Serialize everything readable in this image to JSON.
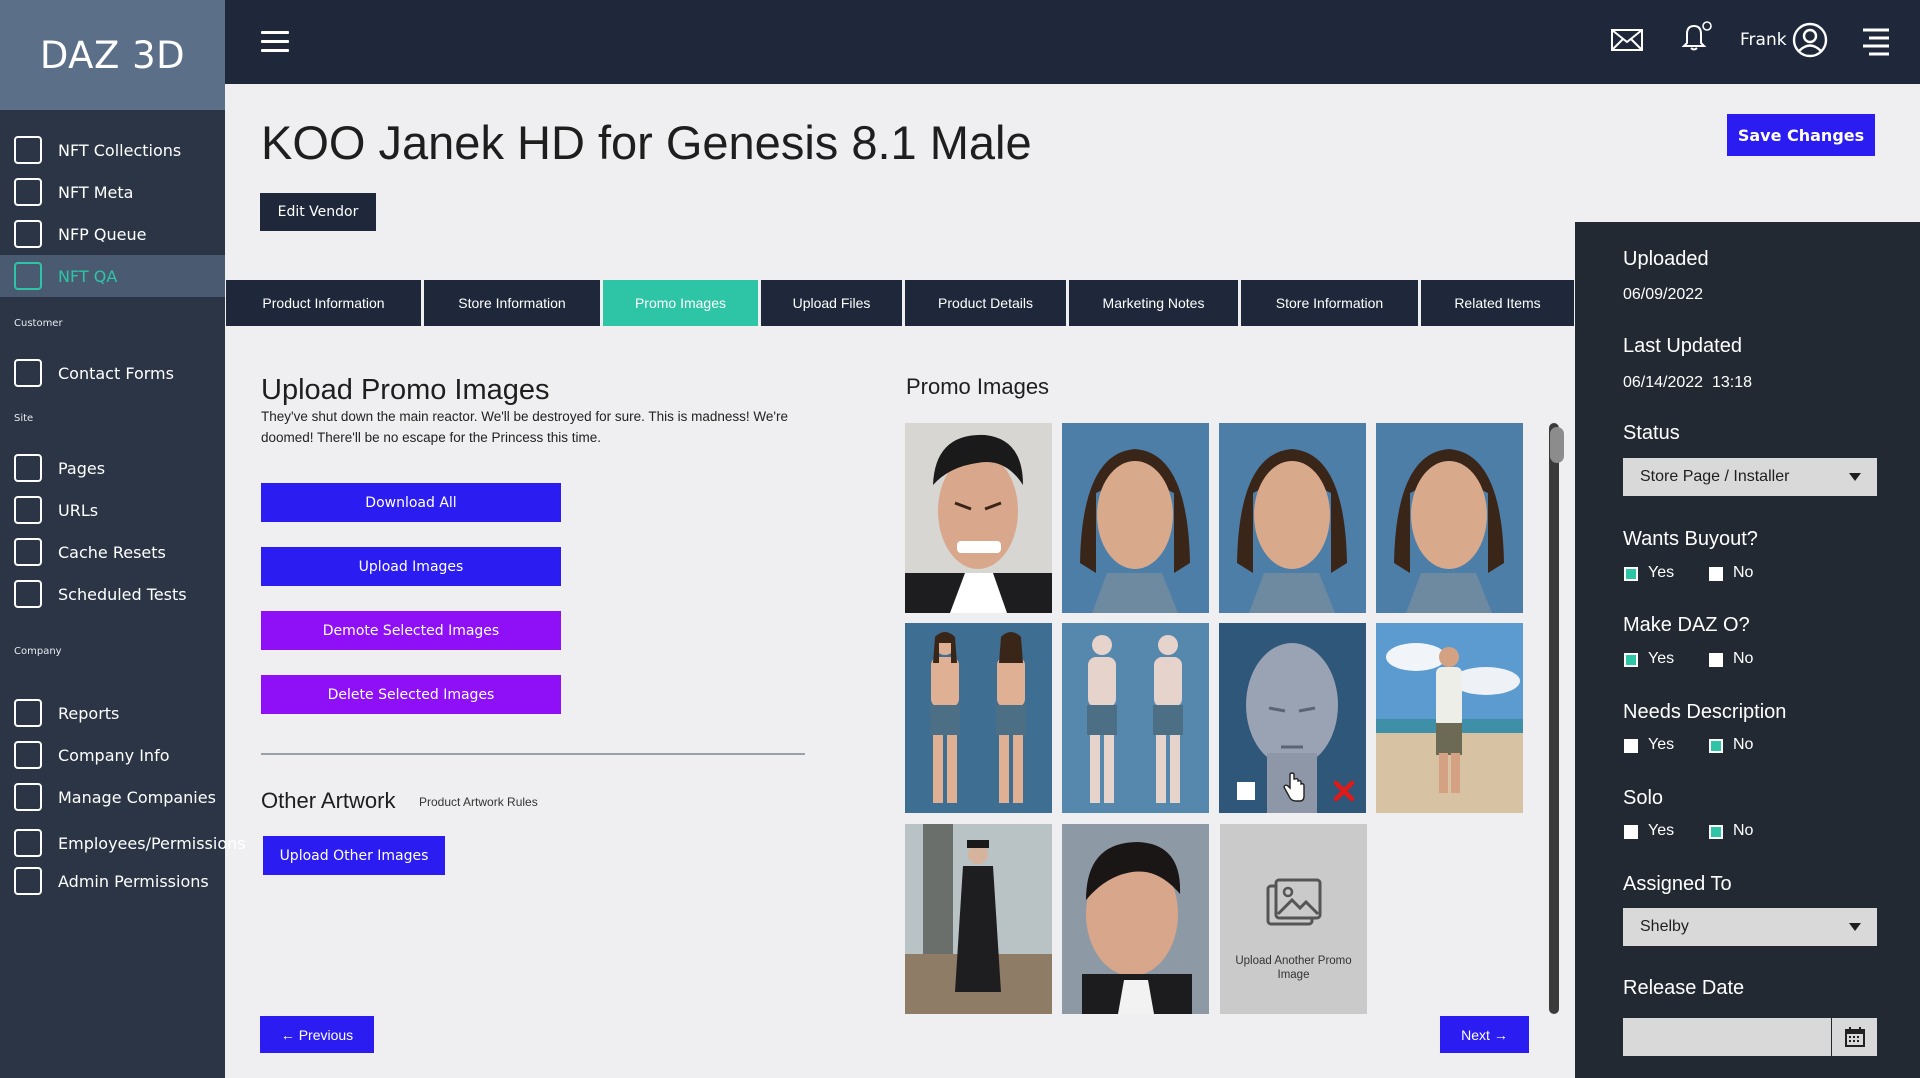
{
  "app": {
    "brand": "DAZ 3D"
  },
  "sidebar": {
    "items_top": [
      {
        "label": "NFT Collections"
      },
      {
        "label": "NFT Meta"
      },
      {
        "label": "NFP Queue"
      },
      {
        "label": "NFT QA",
        "active": true
      }
    ],
    "section_customer": "Customer",
    "items_customer": [
      {
        "label": "Contact Forms"
      }
    ],
    "section_site": "Site",
    "items_site": [
      {
        "label": "Pages"
      },
      {
        "label": "URLs"
      },
      {
        "label": "Cache Resets"
      },
      {
        "label": "Scheduled Tests"
      }
    ],
    "section_company": "Company",
    "items_company": [
      {
        "label": "Reports"
      },
      {
        "label": "Company Info"
      },
      {
        "label": "Manage Companies"
      },
      {
        "label": "Employees/Permissions"
      },
      {
        "label": "Admin Permissions"
      }
    ]
  },
  "topbar": {
    "user_name": "Frank",
    "icons": [
      "menu-icon",
      "mail-icon",
      "bell-icon",
      "user-icon",
      "list-menu-icon"
    ]
  },
  "header": {
    "title": "KOO Janek HD for Genesis 8.1 Male",
    "edit_vendor": "Edit Vendor",
    "save_changes": "Save Changes"
  },
  "tabs": [
    {
      "label": "Product Information"
    },
    {
      "label": "Store Information"
    },
    {
      "label": "Promo Images",
      "active": true
    },
    {
      "label": "Upload Files"
    },
    {
      "label": "Product Details"
    },
    {
      "label": "Marketing Notes"
    },
    {
      "label": "Store Information"
    },
    {
      "label": "Related Items"
    }
  ],
  "upload": {
    "title": "Upload Promo Images",
    "description": "They've shut down the main reactor. We'll be destroyed for sure. This is madness! We're doomed! There'll be no escape for the Princess this time.",
    "download_all": "Download All",
    "upload_images": "Upload Images",
    "demote_selected": "Demote Selected Images",
    "delete_selected": "Delete Selected Images",
    "other_title": "Other Artwork",
    "rules_link": "Product Artwork Rules",
    "upload_other": "Upload Other Images",
    "previous": "← Previous",
    "next": "Next →"
  },
  "promo": {
    "heading": "Promo Images",
    "upload_another": "Upload Another Promo Image",
    "images": [
      "angry-face-portrait",
      "long-hair-portrait",
      "long-hair-portrait",
      "long-hair-portrait",
      "body-front-back-dark",
      "body-front-back-light",
      "bald-head-render",
      "beach-full-body",
      "coat-full-body",
      "dark-hair-portrait"
    ]
  },
  "panel": {
    "uploaded_label": "Uploaded",
    "uploaded_value": "06/09/2022",
    "updated_label": "Last Updated",
    "updated_value": "06/14/2022  13:18",
    "status_label": "Status",
    "status_value": "Store Page / Installer",
    "buyout_label": "Wants Buyout?",
    "make_o_label": "Make DAZ O?",
    "needs_desc_label": "Needs Description",
    "solo_label": "Solo",
    "yes": "Yes",
    "no": "No",
    "assigned_label": "Assigned To",
    "assigned_value": "Shelby",
    "release_label": "Release Date"
  },
  "colors": {
    "accent": "#2ec4a6",
    "primary": "#2b1df2",
    "purple": "#8f10f7",
    "navy": "#1f283a"
  }
}
